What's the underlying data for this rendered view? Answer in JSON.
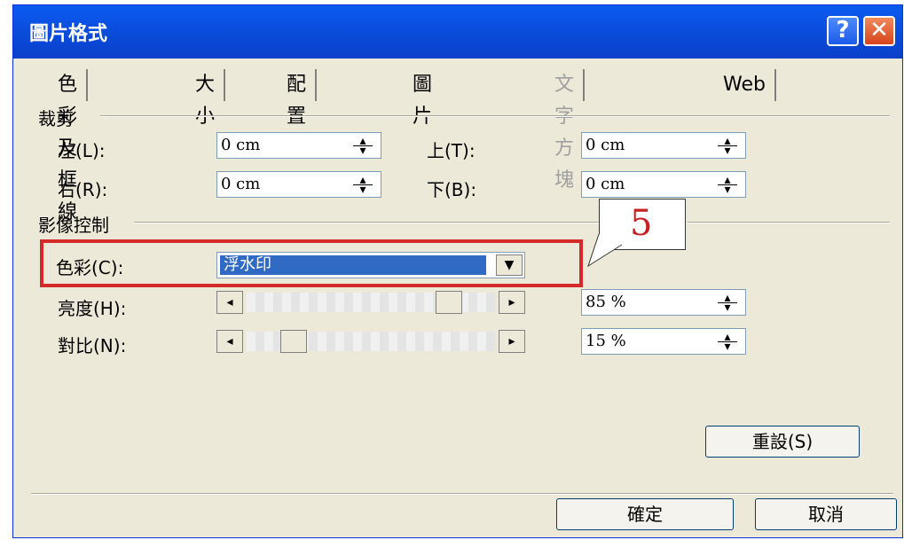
{
  "window": {
    "title": "圖片格式"
  },
  "tabs": [
    {
      "label": "色彩及框線",
      "state": "normal"
    },
    {
      "label": "大小",
      "state": "normal"
    },
    {
      "label": "配置",
      "state": "normal"
    },
    {
      "label": "圖片",
      "state": "active"
    },
    {
      "label": "文字方塊",
      "state": "disabled"
    },
    {
      "label": "Web",
      "state": "normal"
    }
  ],
  "crop": {
    "section_label": "裁剪",
    "left_label": "左(L):",
    "left_value": "0 cm",
    "top_label": "上(T):",
    "top_value": "0 cm",
    "right_label": "右(R):",
    "right_value": "0 cm",
    "bottom_label": "下(B):",
    "bottom_value": "0 cm"
  },
  "image_control": {
    "section_label": "影像控制",
    "color_label": "色彩(C):",
    "color_value": "浮水印",
    "brightness_label": "亮度(H):",
    "brightness_value": "85 %",
    "brightness_level": 85,
    "contrast_label": "對比(N):",
    "contrast_value": "15 %",
    "contrast_level": 15
  },
  "annotation": {
    "step_number": "5",
    "highlight_color": "#d42a2a"
  },
  "buttons": {
    "reset": "重設(S)",
    "ok": "確定",
    "cancel": "取消"
  }
}
